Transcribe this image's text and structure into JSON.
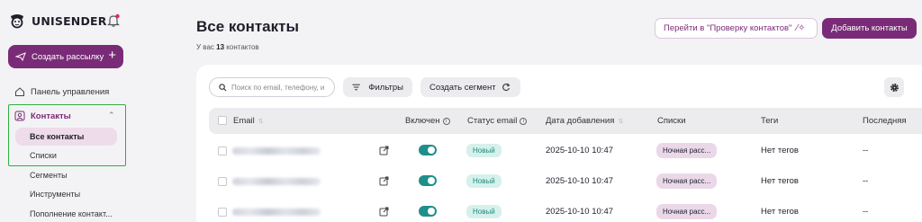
{
  "app": {
    "logo_text": "UNISENDER",
    "create_button": "Создать рассылку"
  },
  "sidebar": {
    "items": [
      {
        "label": "Панель управления"
      },
      {
        "label": "Контакты"
      },
      {
        "label": "Все контакты"
      },
      {
        "label": "Списки"
      },
      {
        "label": "Сегменты"
      },
      {
        "label": "Инструменты"
      },
      {
        "label": "Пополнение контакт..."
      }
    ]
  },
  "header": {
    "title": "Все контакты",
    "subtitle_prefix": "У вас",
    "count": "13",
    "subtitle_suffix": "контактов",
    "check_button": "Перейти в \"Проверку контактов\"",
    "add_button": "Добавить контакты"
  },
  "toolbar": {
    "search_placeholder": "Поиск по email, телефону, и",
    "filters": "Фильтры",
    "segment": "Создать сегмент"
  },
  "table": {
    "columns": [
      "Email",
      "Включен",
      "Статус email",
      "Дата добавления",
      "Списки",
      "Теги",
      "Последняя"
    ],
    "rows": [
      {
        "status": "Новый",
        "date": "2025-10-10 10:47",
        "list": "Ночная расс...",
        "tags": "Нет тегов",
        "last": "--",
        "enabled": true
      },
      {
        "status": "Новый",
        "date": "2025-10-10 10:47",
        "list": "Ночная расс...",
        "tags": "Нет тегов",
        "last": "--",
        "enabled": true
      },
      {
        "status": "Новый",
        "date": "2025-10-10 10:47",
        "list": "Ночная расс...",
        "tags": "Нет тегов",
        "last": "--",
        "enabled": true
      }
    ]
  },
  "colors": {
    "brand": "#7a2b78",
    "highlight_box": "#2fae3f",
    "toggle_on": "#1e8f8a"
  }
}
